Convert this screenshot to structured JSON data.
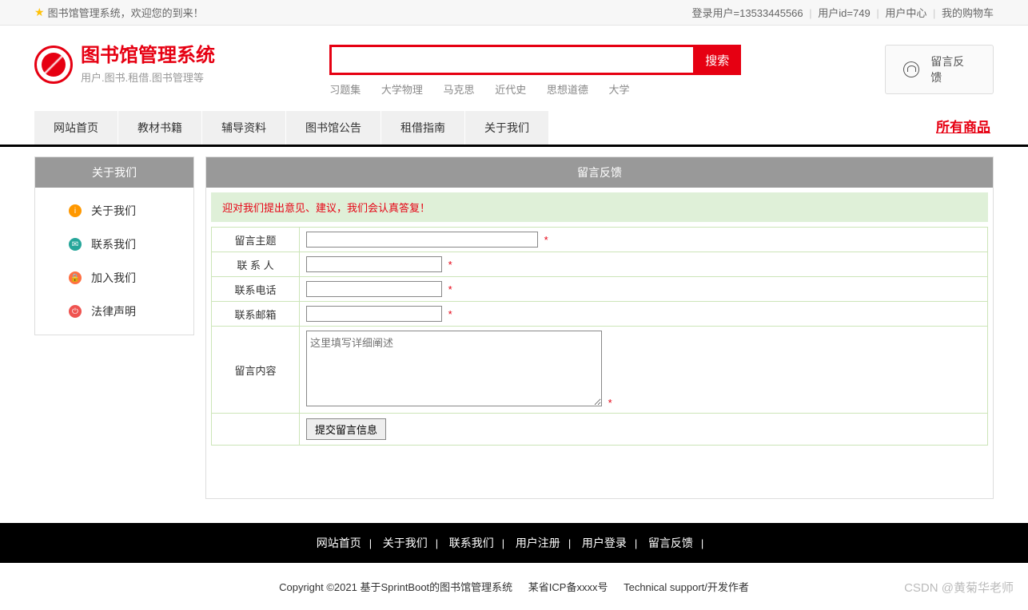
{
  "topbar": {
    "welcome": "图书馆管理系统，欢迎您的到来！",
    "user_label": "登录用户=13533445566",
    "userid_label": "用户id=749",
    "user_center": "用户中心",
    "my_cart": "我的购物车"
  },
  "logo": {
    "title": "图书馆管理系统",
    "subtitle": "用户.图书.租借.图书管理等"
  },
  "search": {
    "placeholder": "",
    "button": "搜索",
    "hot": [
      "习题集",
      "大学物理",
      "马克思",
      "近代史",
      "思想道德",
      "大学"
    ]
  },
  "feedback_button": "留言反馈",
  "nav": {
    "items": [
      "网站首页",
      "教材书籍",
      "辅导资料",
      "图书馆公告",
      "租借指南",
      "关于我们"
    ],
    "all": "所有商品"
  },
  "sidebar": {
    "header": "关于我们",
    "items": [
      {
        "label": "关于我们",
        "iconClass": "icon-orange",
        "glyph": "i"
      },
      {
        "label": "联系我们",
        "iconClass": "icon-teal",
        "glyph": "✉"
      },
      {
        "label": "加入我们",
        "iconClass": "icon-orange2",
        "glyph": "🔒"
      },
      {
        "label": "法律声明",
        "iconClass": "icon-red",
        "glyph": "⏻"
      }
    ]
  },
  "content": {
    "header": "留言反馈",
    "tip": "迎对我们提出意见、建议，我们会认真答复！",
    "labels": {
      "subject": "留言主题",
      "contact": "联 系 人",
      "phone": "联系电话",
      "email": "联系邮箱",
      "body": "留言内容"
    },
    "textarea_placeholder": "这里填写详细阐述",
    "submit": "提交留言信息",
    "required": "*"
  },
  "footer": {
    "links": [
      "网站首页",
      "关于我们",
      "联系我们",
      "用户注册",
      "用户登录",
      "留言反馈"
    ],
    "copyright": "Copyright ©2021 基于SprintBoot的图书馆管理系统",
    "icp": "某省ICP备xxxx号",
    "tech": "Technical support/开发作者"
  },
  "watermark": "CSDN @黄菊华老师"
}
